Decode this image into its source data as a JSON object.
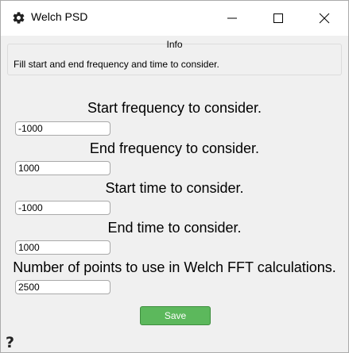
{
  "window": {
    "title": "Welch PSD",
    "icon": "gear-icon",
    "controls": [
      "minimize-icon",
      "maximize-icon",
      "close-icon"
    ]
  },
  "info": {
    "title": "Info",
    "text": "Fill start and end frequency and time to consider."
  },
  "fields": [
    {
      "label": "Start frequency to consider.",
      "value": "-1000"
    },
    {
      "label": "End frequency to consider.",
      "value": "1000"
    },
    {
      "label": "Start time to consider.",
      "value": "-1000"
    },
    {
      "label": "End time to consider.",
      "value": "1000"
    },
    {
      "label": "Number of points to use in Welch FFT calculations.",
      "value": "2500"
    }
  ],
  "save_label": "Save",
  "help": {
    "icon": "question-icon",
    "glyph": "?"
  },
  "colors": {
    "save_button": "#5cb85c",
    "save_text": "#ffffff",
    "titlebar": "#ffffff",
    "background": "#f0f0f0"
  }
}
